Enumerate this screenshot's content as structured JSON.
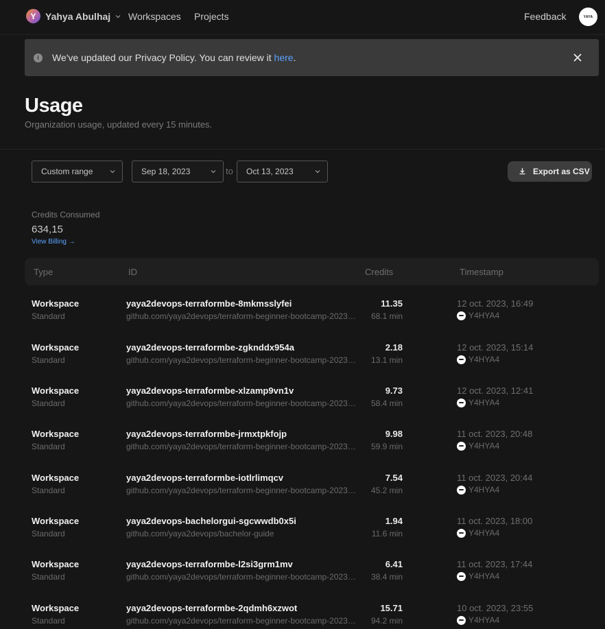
{
  "nav": {
    "org_initial": "Y",
    "org_name": "Yahya Abulhaj",
    "links": [
      "Workspaces",
      "Projects"
    ],
    "feedback": "Feedback",
    "user_avatar_text": "YAYA"
  },
  "banner": {
    "text": "We've updated our Privacy Policy. You can review it ",
    "link": "here",
    "suffix": "."
  },
  "header": {
    "title": "Usage",
    "subtitle": "Organization usage, updated every 15 minutes."
  },
  "filters": {
    "range": "Custom range",
    "from": "Sep 18, 2023",
    "to_label": "to",
    "to": "Oct 13, 2023",
    "export": "Export as CSV"
  },
  "credits": {
    "label": "Credits Consumed",
    "value": "634,15",
    "billing_link": "View Billing →"
  },
  "table": {
    "headers": [
      "Type",
      "ID",
      "Credits",
      "Timestamp"
    ],
    "rows": [
      {
        "type": "Workspace",
        "class": "Standard",
        "id": "yaya2devops-terraformbe-8mkmsslyfei",
        "repo": "github.com/yaya2devops/terraform-beginner-bootcamp-2023/...",
        "credits": "11.35",
        "minutes": "68.1 min",
        "timestamp": "12 oct. 2023, 16:49",
        "user": "Y4HYA4"
      },
      {
        "type": "Workspace",
        "class": "Standard",
        "id": "yaya2devops-terraformbe-zgknddx954a",
        "repo": "github.com/yaya2devops/terraform-beginner-bootcamp-2023/...",
        "credits": "2.18",
        "minutes": "13.1 min",
        "timestamp": "12 oct. 2023, 15:14",
        "user": "Y4HYA4"
      },
      {
        "type": "Workspace",
        "class": "Standard",
        "id": "yaya2devops-terraformbe-xlzamp9vn1v",
        "repo": "github.com/yaya2devops/terraform-beginner-bootcamp-2023/...",
        "credits": "9.73",
        "minutes": "58.4 min",
        "timestamp": "12 oct. 2023, 12:41",
        "user": "Y4HYA4"
      },
      {
        "type": "Workspace",
        "class": "Standard",
        "id": "yaya2devops-terraformbe-jrmxtpkfojp",
        "repo": "github.com/yaya2devops/terraform-beginner-bootcamp-2023/...",
        "credits": "9.98",
        "minutes": "59.9 min",
        "timestamp": "11 oct. 2023, 20:48",
        "user": "Y4HYA4"
      },
      {
        "type": "Workspace",
        "class": "Standard",
        "id": "yaya2devops-terraformbe-iotlrlimqcv",
        "repo": "github.com/yaya2devops/terraform-beginner-bootcamp-2023/...",
        "credits": "7.54",
        "minutes": "45.2 min",
        "timestamp": "11 oct. 2023, 20:44",
        "user": "Y4HYA4"
      },
      {
        "type": "Workspace",
        "class": "Standard",
        "id": "yaya2devops-bachelorgui-sgcwwdb0x5i",
        "repo": "github.com/yaya2devops/bachelor-guide",
        "credits": "1.94",
        "minutes": "11.6 min",
        "timestamp": "11 oct. 2023, 18:00",
        "user": "Y4HYA4"
      },
      {
        "type": "Workspace",
        "class": "Standard",
        "id": "yaya2devops-terraformbe-l2si3grm1mv",
        "repo": "github.com/yaya2devops/terraform-beginner-bootcamp-2023/...",
        "credits": "6.41",
        "minutes": "38.4 min",
        "timestamp": "11 oct. 2023, 17:44",
        "user": "Y4HYA4"
      },
      {
        "type": "Workspace",
        "class": "Standard",
        "id": "yaya2devops-terraformbe-2qdmh6xzwot",
        "repo": "github.com/yaya2devops/terraform-beginner-bootcamp-2023/...",
        "credits": "15.71",
        "minutes": "94.2 min",
        "timestamp": "10 oct. 2023, 23:55",
        "user": "Y4HYA4"
      }
    ]
  }
}
